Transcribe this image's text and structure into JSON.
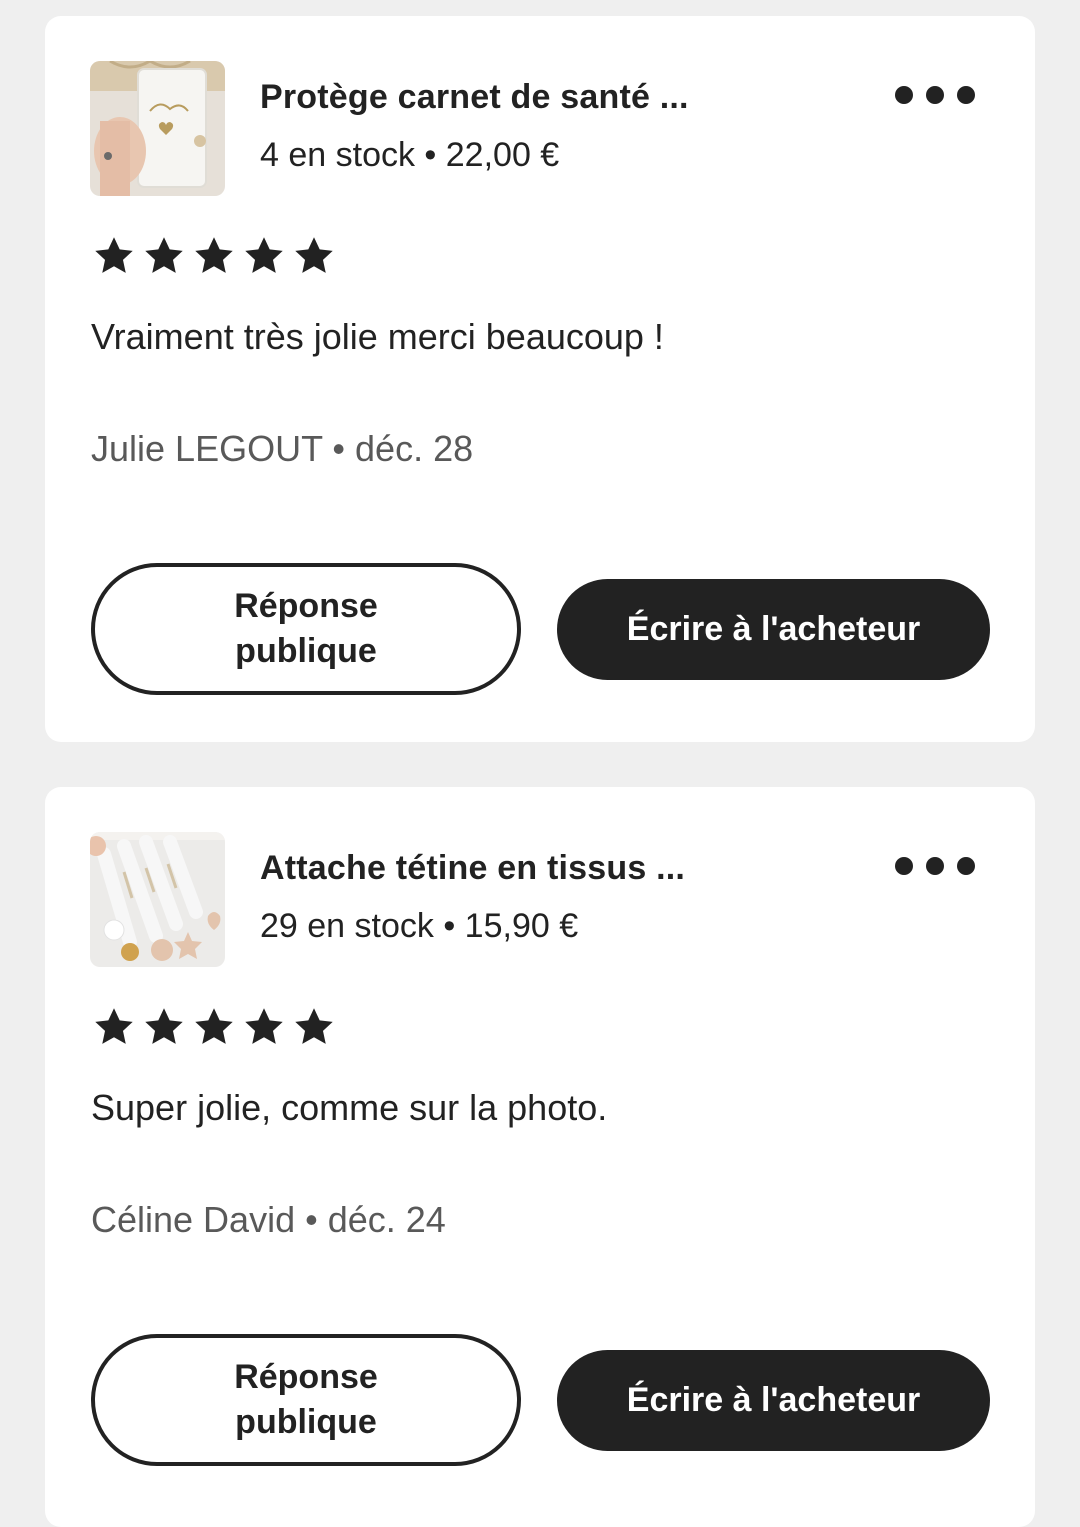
{
  "reviews": [
    {
      "product": {
        "title": "Protège carnet de santé ...",
        "stock_price": "4 en stock • 22,00 €",
        "thumbnail_icon": "product-photo-health-book-cover"
      },
      "rating": 5,
      "text": "Vraiment très jolie merci beaucoup !",
      "meta": "Julie LEGOUT • déc. 28",
      "public_reply_label": "Réponse publique",
      "message_buyer_label": "Écrire à l'acheteur"
    },
    {
      "product": {
        "title": "Attache tétine en tissus ...",
        "stock_price": "29 en stock • 15,90 €",
        "thumbnail_icon": "product-photo-pacifier-clips"
      },
      "rating": 5,
      "text": "Super jolie, comme sur la photo.",
      "meta": "Céline David • déc. 24",
      "public_reply_label": "Réponse publique",
      "message_buyer_label": "Écrire à l'acheteur"
    }
  ],
  "colors": {
    "background": "#efefef",
    "card": "#ffffff",
    "text": "#222222",
    "muted_text": "#595959",
    "primary_button": "#222222"
  },
  "icons": {
    "star": "star-icon",
    "more": "more-options-icon"
  }
}
